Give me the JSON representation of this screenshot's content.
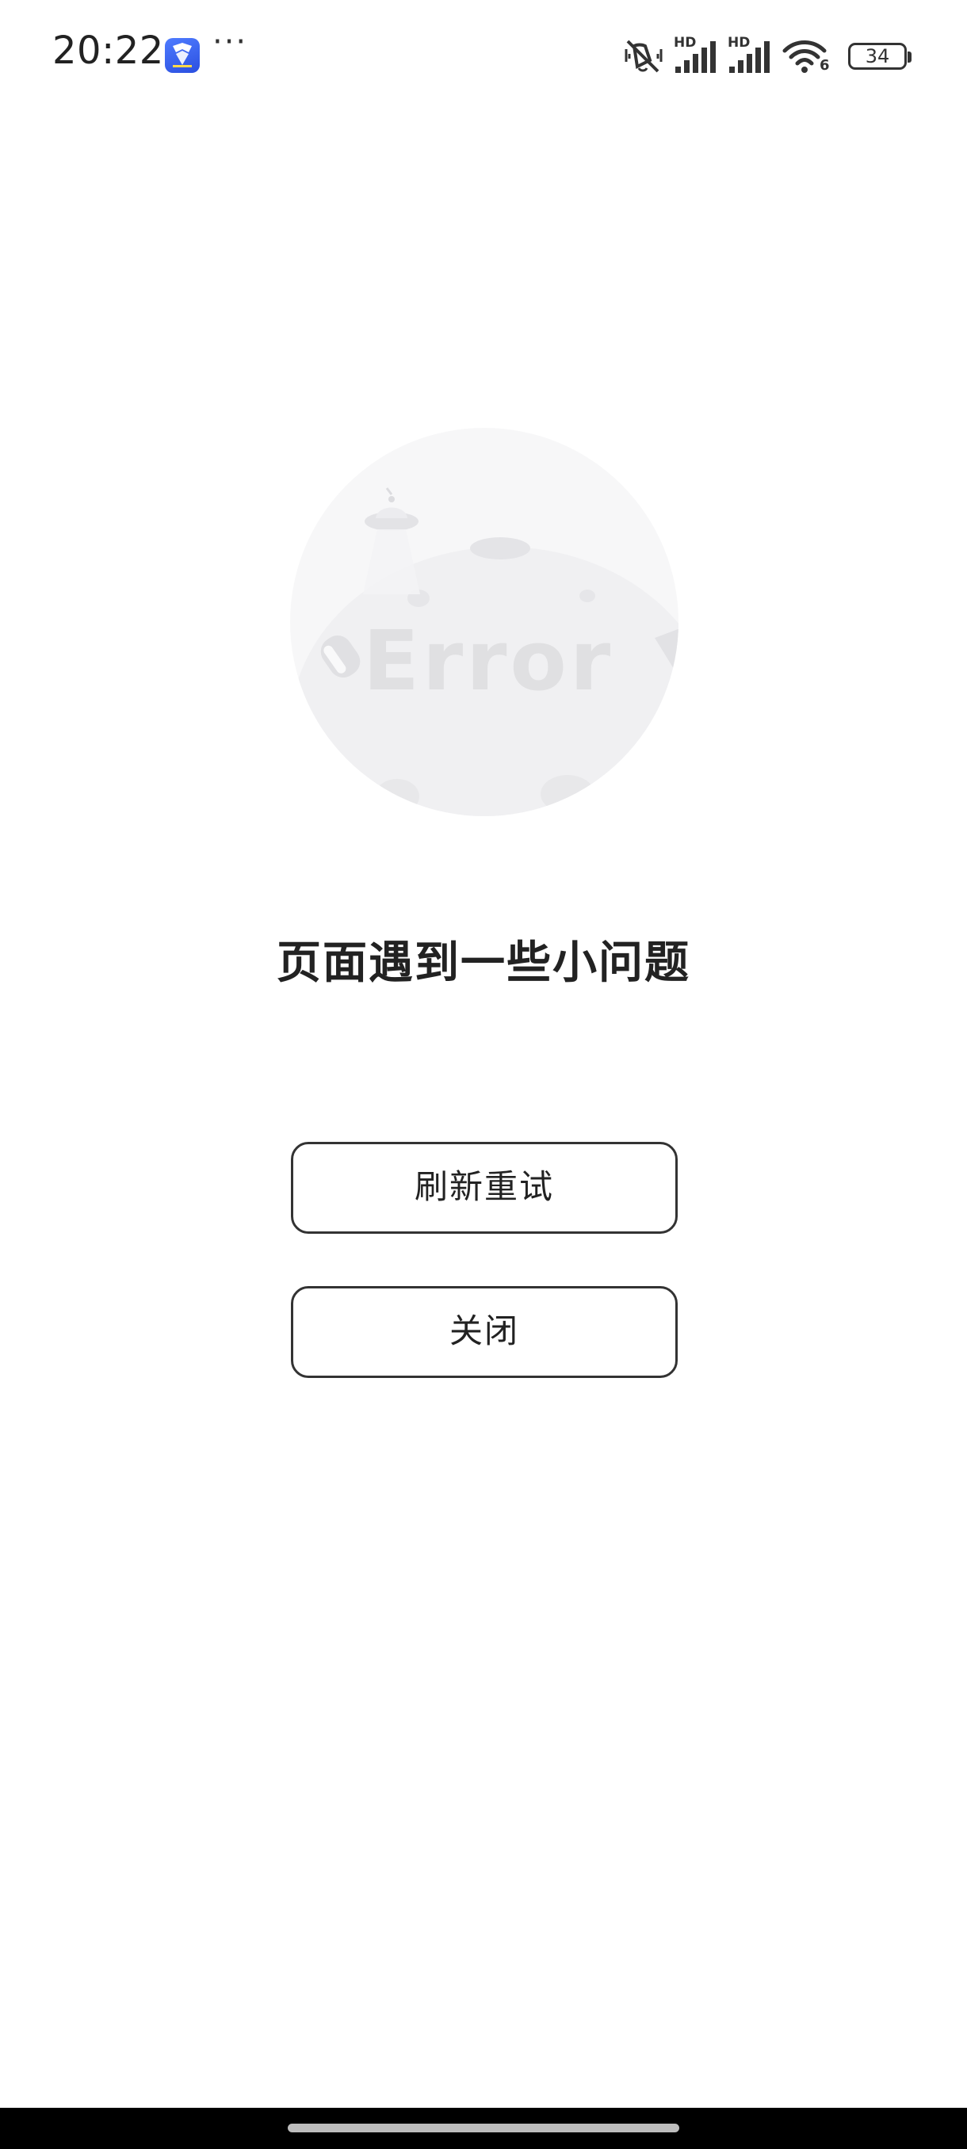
{
  "status_bar": {
    "time": "20:22",
    "more": "···",
    "battery_level": "34",
    "network_1_label": "HD",
    "network_2_label": "HD",
    "wifi_badge": "6",
    "icons": [
      "app-notification-icon",
      "mute-vibrate-icon",
      "signal-icon",
      "signal-icon",
      "wifi-icon",
      "battery-icon"
    ]
  },
  "illustration": {
    "text": "Error"
  },
  "error": {
    "title": "页面遇到一些小问题"
  },
  "actions": {
    "retry_label": "刷新重试",
    "close_label": "关闭"
  }
}
